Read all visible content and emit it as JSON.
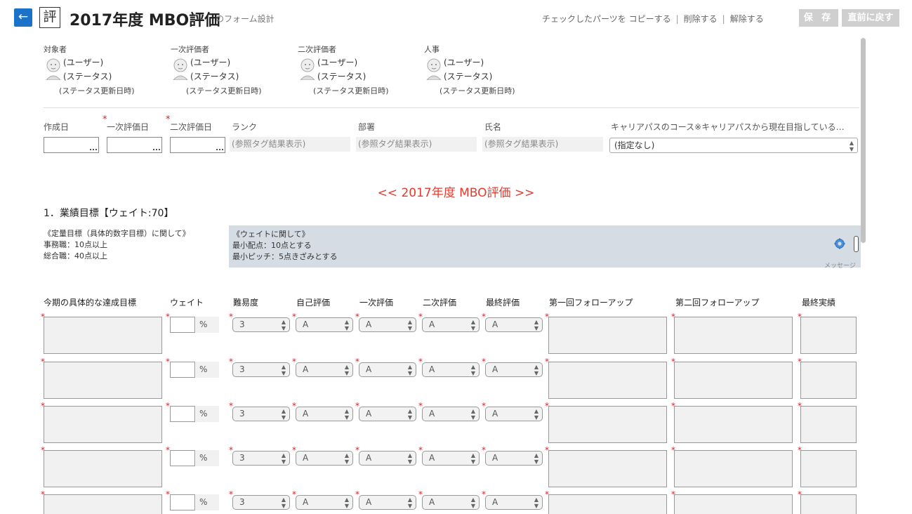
{
  "header": {
    "back_glyph": "←",
    "form_badge": "評",
    "title": "2017年度 MBO評価",
    "subtitle": "のフォーム設計",
    "checked_parts_prefix": "チェックしたパーツを",
    "copy_label": "コピーする",
    "delete_label": "削除する",
    "release_label": "解除する",
    "separator": "|",
    "save_label": "保 存",
    "revert_label": "直前に戻す"
  },
  "evaluators": [
    {
      "role": "対象者",
      "user": "(ユーザー)",
      "status": "(ステータス)",
      "updated": "(ステータス更新日時)"
    },
    {
      "role": "一次評価者",
      "user": "(ユーザー)",
      "status": "(ステータス)",
      "updated": "(ステータス更新日時)"
    },
    {
      "role": "二次評価者",
      "user": "(ユーザー)",
      "status": "(ステータス)",
      "updated": "(ステータス更新日時)"
    },
    {
      "role": "人事",
      "user": "(ユーザー)",
      "status": "(ステータス)",
      "updated": "(ステータス更新日時)"
    }
  ],
  "fields": {
    "created_label": "作成日",
    "first_eval_date_label": "一次評価日",
    "second_eval_date_label": "二次評価日",
    "rank_label": "ランク",
    "department_label": "部署",
    "name_label": "氏名",
    "career_label": "キャリアパスのコース※キャリアパスから現在目指している…",
    "ref_placeholder": "(参照タグ結果表示)",
    "career_value": "(指定なし)",
    "required_mark": "*"
  },
  "section": {
    "banner": "<< 2017年度 MBO評価 >>",
    "heading": "1．業績目標【ウェイト:70】",
    "note_left": [
      "《定量目標（具体的数字目標）に関して》",
      "事務職：10点以上",
      "総合職：40点以上"
    ],
    "note_right": [
      "《ウェイトに関して》",
      "最小配点：10点とする",
      "最小ピッチ：5点きざみとする"
    ],
    "message_label": "メッセージ"
  },
  "table": {
    "headers": [
      "今期の具体的な達成目標",
      "ウェイト",
      "難易度",
      "自己評価",
      "一次評価",
      "二次評価",
      "最終評価",
      "第一回フォローアップ",
      "第二回フォローアップ",
      "最終実績"
    ],
    "percent": "%",
    "rows": [
      {
        "difficulty": "3",
        "self": "A",
        "first": "A",
        "second": "A",
        "final": "A"
      },
      {
        "difficulty": "3",
        "self": "A",
        "first": "A",
        "second": "A",
        "final": "A"
      },
      {
        "difficulty": "3",
        "self": "A",
        "first": "A",
        "second": "A",
        "final": "A"
      },
      {
        "difficulty": "3",
        "self": "A",
        "first": "A",
        "second": "A",
        "final": "A"
      },
      {
        "difficulty": "3",
        "self": "A",
        "first": "A",
        "second": "A",
        "final": "A"
      }
    ]
  },
  "colors": {
    "accent_blue": "#1a73c9",
    "required_red": "#e02020",
    "banner_red": "#e83a2c",
    "note_bg": "#d5dce4"
  }
}
